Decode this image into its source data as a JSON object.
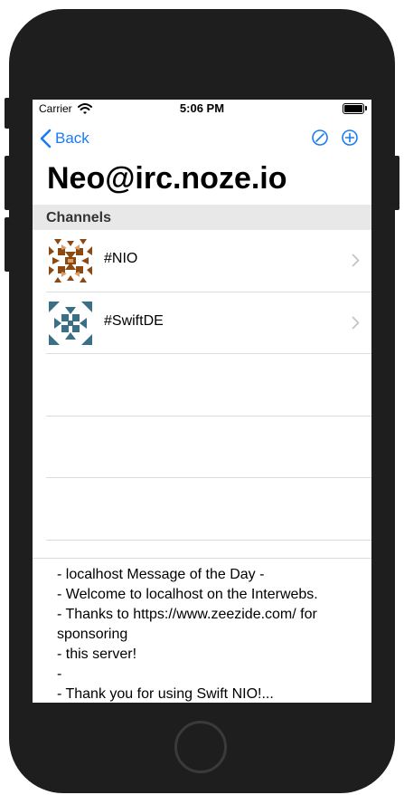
{
  "status_bar": {
    "carrier": "Carrier",
    "time": "5:06 PM"
  },
  "nav": {
    "back_label": "Back"
  },
  "title": "Neo@irc.noze.io",
  "section_header": "Channels",
  "channels": [
    {
      "name": "#NIO",
      "avatar_color": "#8b4a12"
    },
    {
      "name": "#SwiftDE",
      "avatar_color": "#3a6f86"
    }
  ],
  "motd_lines": [
    "- localhost Message of the Day -",
    "- Welcome to localhost on the Interwebs.",
    "- Thanks to https://www.zeezide.com/ for sponsoring",
    "- this server!",
    "-",
    "- Thank you for using Swift NIO!..."
  ],
  "colors": {
    "accent": "#1a7cf5",
    "phone_body": "#1e1e1e",
    "section_bg": "#e8e8e8"
  }
}
